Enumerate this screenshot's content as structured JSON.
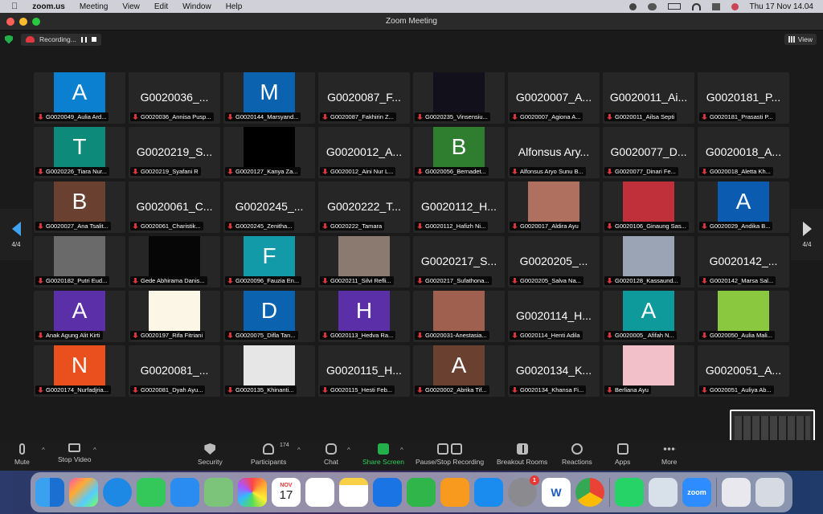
{
  "menubar": {
    "app": "zoom.us",
    "items": [
      "Meeting",
      "View",
      "Edit",
      "Window",
      "Help"
    ],
    "datetime": "Thu 17 Nov  14.04"
  },
  "window": {
    "title": "Zoom Meeting",
    "recording_label": "Recording...",
    "view_label": "View"
  },
  "pager": {
    "left": "4/4",
    "right": "4/4"
  },
  "participants": [
    {
      "label": "G0020049_Aulia Ard...",
      "kind": "letter",
      "letter": "A",
      "color": "#0b7fd0"
    },
    {
      "label": "G0020036_Annisa Pusp...",
      "kind": "name",
      "big": "G0020036_..."
    },
    {
      "label": "G0020144_Marsyand...",
      "kind": "letter",
      "letter": "M",
      "color": "#0b63b0"
    },
    {
      "label": "G0020087_Fakhirin Z...",
      "kind": "name",
      "big": "G0020087_F..."
    },
    {
      "label": "G0020235_Vinsensiu...",
      "kind": "video",
      "color": "#12101a"
    },
    {
      "label": "G0020007_Agiona A...",
      "kind": "name",
      "big": "G0020007_A..."
    },
    {
      "label": "G0020011_Ailsa Septi",
      "kind": "name",
      "big": "G0020011_Ai..."
    },
    {
      "label": "G0020181_Prasasti P...",
      "kind": "name",
      "big": "G0020181_P..."
    },
    {
      "label": "G0020226_Tiara Nur...",
      "kind": "letter",
      "letter": "T",
      "color": "#0e8a7a"
    },
    {
      "label": "G0020219_Syafani R",
      "kind": "name",
      "big": "G0020219_S..."
    },
    {
      "label": "G0020127_Kanya Za...",
      "kind": "video",
      "color": "#000000"
    },
    {
      "label": "G0020012_Aini Nur L...",
      "kind": "name",
      "big": "G0020012_A..."
    },
    {
      "label": "G0020056_Bernadet...",
      "kind": "letter",
      "letter": "B",
      "color": "#2f7d2f"
    },
    {
      "label": "Alfonsus Aryo Sunu B...",
      "kind": "name",
      "big": "Alfonsus Ary..."
    },
    {
      "label": "G0020077_Dinari Fe...",
      "kind": "name",
      "big": "G0020077_D..."
    },
    {
      "label": "G0020018_Aletta Kh...",
      "kind": "name",
      "big": "G0020018_A..."
    },
    {
      "label": "G0020027_Ana Tsalit...",
      "kind": "letter",
      "letter": "B",
      "color": "#6a4030"
    },
    {
      "label": "G0020061_Charistik...",
      "kind": "name",
      "big": "G0020061_C..."
    },
    {
      "label": "G0020245_Zenitha...",
      "kind": "name",
      "big": "G0020245_..."
    },
    {
      "label": "G0020222_Tamara",
      "kind": "name",
      "big": "G0020222_T..."
    },
    {
      "label": "G0020112_Hafizh Ni...",
      "kind": "name",
      "big": "G0020112_H..."
    },
    {
      "label": "G0020017_Aldira Ayu",
      "kind": "video",
      "color": "#b07060"
    },
    {
      "label": "G0020106_Ginaung Sas...",
      "kind": "video",
      "color": "#c0303a"
    },
    {
      "label": "G0020029_Andika B...",
      "kind": "letter",
      "letter": "A",
      "color": "#0b5bb0"
    },
    {
      "label": "G0020182_Putri Eud...",
      "kind": "video",
      "color": "#6a6a6a"
    },
    {
      "label": "Gede Abhirama Danis...",
      "kind": "video",
      "color": "#060606"
    },
    {
      "label": "G0020096_Fauzia En...",
      "kind": "letter",
      "letter": "F",
      "color": "#129aa8"
    },
    {
      "label": "G0020211_Silvi Refli...",
      "kind": "video",
      "color": "#8a7a70"
    },
    {
      "label": "G0020217_Sufathona...",
      "kind": "name",
      "big": "G0020217_S..."
    },
    {
      "label": "G0020205_Salva Na...",
      "kind": "name",
      "big": "G0020205_..."
    },
    {
      "label": "G0020128_Kassaund...",
      "kind": "video",
      "color": "#9aa4b4"
    },
    {
      "label": "G0020142_Marsa Sal...",
      "kind": "name",
      "big": "G0020142_..."
    },
    {
      "label": "Anak Agung Alit Kirti",
      "kind": "letter",
      "letter": "A",
      "color": "#5a2fa8"
    },
    {
      "label": "G0020197_Rifa Fitriani",
      "kind": "video",
      "color": "#fbf6e6"
    },
    {
      "label": "G0020075_Difla Tan...",
      "kind": "letter",
      "letter": "D",
      "color": "#0b63b0"
    },
    {
      "label": "G0020113_Hedva Ra...",
      "kind": "letter",
      "letter": "H",
      "color": "#5a2fa8"
    },
    {
      "label": "G0020031-Anestasia...",
      "kind": "video",
      "color": "#a06050"
    },
    {
      "label": "G0020114_Henti Adila",
      "kind": "name",
      "big": "G0020114_H..."
    },
    {
      "label": "G0020005_ Afifah N...",
      "kind": "letter",
      "letter": "A",
      "color": "#0e9a9a"
    },
    {
      "label": "G0020050_Aulia Mali...",
      "kind": "video",
      "color": "#8ac840"
    },
    {
      "label": "G0020174_Nurfadjria...",
      "kind": "letter",
      "letter": "N",
      "color": "#e9501e"
    },
    {
      "label": "G0020081_Dyah Ayu...",
      "kind": "name",
      "big": "G0020081_..."
    },
    {
      "label": "G0020135_Khinanti...",
      "kind": "video",
      "color": "#e6e6e6"
    },
    {
      "label": "G0020115_Hesti Feb...",
      "kind": "name",
      "big": "G0020115_H..."
    },
    {
      "label": "G0020002_Abrika Tif...",
      "kind": "letter",
      "letter": "A",
      "color": "#6a4030"
    },
    {
      "label": "G0020134_Khansa Fi...",
      "kind": "name",
      "big": "G0020134_K..."
    },
    {
      "label": "Berliana Ayu",
      "kind": "video",
      "color": "#f2c0c8"
    },
    {
      "label": "G0020051_Auliya Ab...",
      "kind": "name",
      "big": "G0020051_A..."
    }
  ],
  "toolbar": {
    "mute": "Mute",
    "stop_video": "Stop Video",
    "security": "Security",
    "participants": "Participants",
    "participants_count": "174",
    "chat": "Chat",
    "share_screen": "Share Screen",
    "pause_stop_recording": "Pause/Stop Recording",
    "breakout_rooms": "Breakout Rooms",
    "reactions": "Reactions",
    "apps": "Apps",
    "more": "More"
  },
  "dock": {
    "calendar_month": "NOV",
    "calendar_day": "17",
    "settings_badge": "1",
    "zoom_label": "zoom",
    "word_label": "W"
  },
  "colors": {
    "share_green": "#23b04a",
    "record_red": "#e0383e",
    "muted_red": "#e0383e"
  }
}
